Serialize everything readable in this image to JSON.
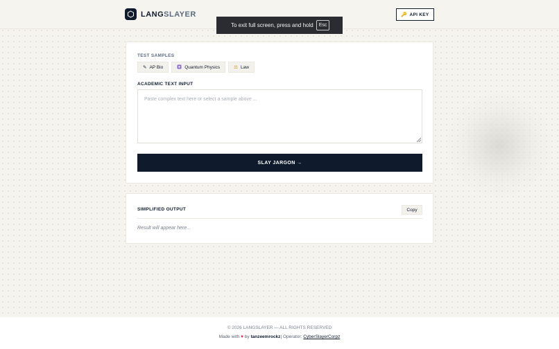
{
  "header": {
    "logo_part1": "LANG",
    "logo_part2": "SLAYER",
    "api_key_label": "API KEY"
  },
  "fullscreen_toast": {
    "message": "To exit full screen, press and hold",
    "key": "Esc"
  },
  "samples": {
    "label": "TEST SAMPLES",
    "items": [
      {
        "label": "AP Bio",
        "icon": "pencil-icon"
      },
      {
        "label": "Quantum Physics",
        "icon": "atom-box-icon"
      },
      {
        "label": "Law",
        "icon": "scales-icon"
      }
    ]
  },
  "input": {
    "label": "ACADEMIC TEXT INPUT",
    "placeholder": "Paste complex text here or select a sample above ...",
    "value": ""
  },
  "action": {
    "label": "SLAY JARGON →"
  },
  "output": {
    "label": "SIMPLIFIED OUTPUT",
    "copy_label": "Copy",
    "result_placeholder": "Result will appear here..."
  },
  "footer": {
    "copyright": "© 2026 LANGSLAYER — ALL RIGHTS RESERVED",
    "made_with": "Made with",
    "by": "by",
    "author": "tanzeemrockz",
    "separator": "|",
    "operator_label": "Operator:",
    "operator": "CyberSlayerCorpz"
  },
  "colors": {
    "navy": "#0f1b2d",
    "background": "#f6f4ef",
    "accent_key": "#d9a21b",
    "heart": "#e0245e"
  }
}
